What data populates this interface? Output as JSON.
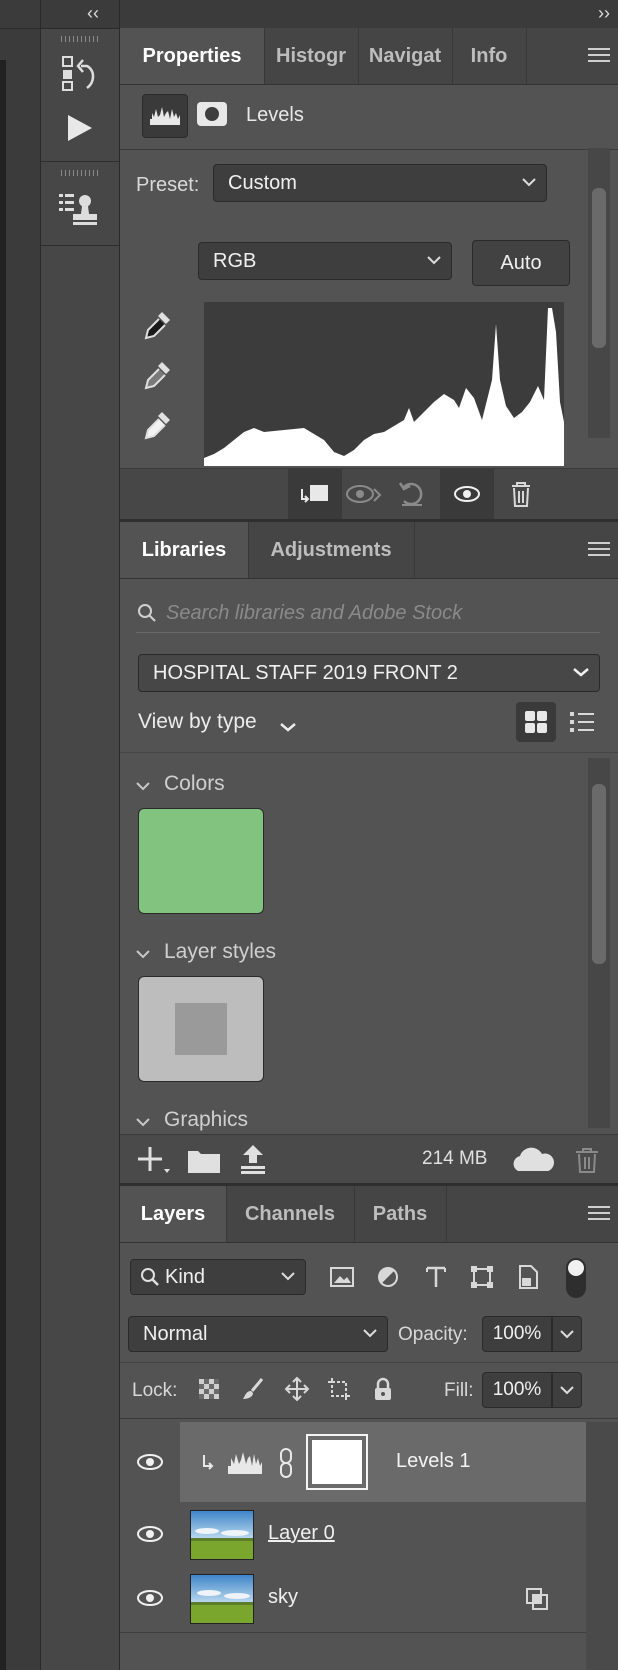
{
  "collapse_left": "‹‹",
  "collapse_right": "››",
  "properties": {
    "tabs": [
      "Properties",
      "Histogr",
      "Navigat",
      "Info"
    ],
    "mode_title": "Levels",
    "preset_label": "Preset:",
    "preset_value": "Custom",
    "channel_value": "RGB",
    "auto_label": "Auto"
  },
  "libraries": {
    "tabs": [
      "Libraries",
      "Adjustments"
    ],
    "search_placeholder": "Search libraries and Adobe Stock",
    "library_name": "HOSPITAL STAFF 2019 FRONT 2",
    "view_by": "View by type",
    "sections": [
      "Colors",
      "Layer styles",
      "Graphics"
    ],
    "color_swatch": "#82c47f",
    "storage": "214 MB"
  },
  "layers": {
    "tabs": [
      "Layers",
      "Channels",
      "Paths"
    ],
    "kind_label": "Kind",
    "blend_mode": "Normal",
    "opacity_label": "Opacity:",
    "opacity_value": "100%",
    "lock_label": "Lock:",
    "fill_label": "Fill:",
    "fill_value": "100%",
    "rows": [
      {
        "name": "Levels 1"
      },
      {
        "name": "Layer 0"
      },
      {
        "name": "sky"
      }
    ]
  },
  "colors": {
    "panel_bg": "#535353",
    "tab_bg": "#454545",
    "accent_green": "#82c47f"
  }
}
